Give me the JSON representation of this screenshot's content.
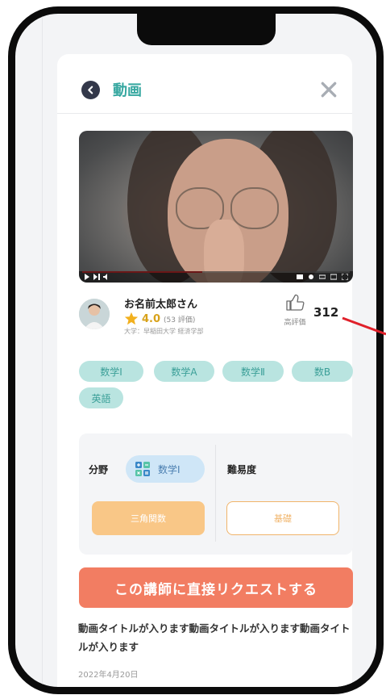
{
  "header": {
    "title": "動画"
  },
  "video": {
    "progress": 0.45
  },
  "teacher": {
    "name": "お名前太郎さん",
    "rating": "4.0",
    "rating_count": "(53 評価)",
    "university": "大学：早稲田大学 経済学部",
    "like_label": "高評価",
    "like_count": "312"
  },
  "tags": [
    "数学Ⅰ",
    "数学A",
    "数学Ⅱ",
    "数B",
    "英語"
  ],
  "field": {
    "label": "分野",
    "subject": "数学Ⅰ",
    "difficulty_label": "難易度",
    "topic": "三角関数",
    "level": "基礎"
  },
  "cta": {
    "label": "この講師に直接リクエストする"
  },
  "detail": {
    "title": "動画タイトルが入ります動画タイトルが入ります動画タイトルが入ります",
    "date": "2022年4月20日"
  },
  "colors": {
    "accent": "#35a7a0",
    "tag_bg": "#b9e4e0",
    "cta": "#f27d62",
    "topic": "#f9c787",
    "annotation": "#e0202a"
  },
  "icons": [
    "back-arrow-icon",
    "close-icon",
    "star-icon",
    "thumbs-up-icon",
    "subject-icon"
  ]
}
